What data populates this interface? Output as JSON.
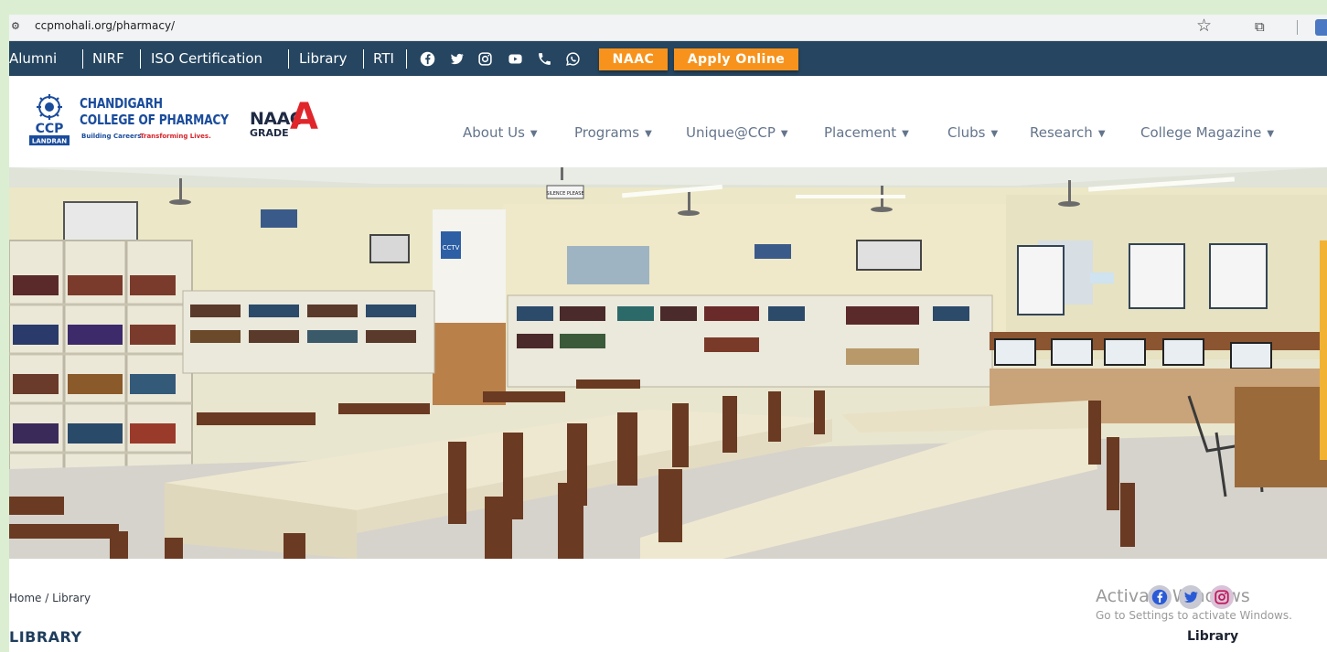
{
  "browser": {
    "url": "ccpmohali.org/pharmacy/"
  },
  "topbar": {
    "links": [
      "Alumni",
      "NIRF",
      "ISO Certification",
      "Library",
      "RTI"
    ],
    "social_icons": [
      "facebook-icon",
      "twitter-icon",
      "instagram-icon",
      "youtube-icon",
      "phone-icon",
      "whatsapp-icon"
    ],
    "naac_label": "NAAC",
    "apply_label": "Apply Online",
    "bar_color": "#254560",
    "accent_color": "#f7931d"
  },
  "logo": {
    "line1": "CHANDIGARH",
    "line2": "COLLEGE OF PHARMACY",
    "badge": "CCP",
    "place": "LANDRAN",
    "tagline_a": "Building Careers.",
    "tagline_b": "Transforming Lives.",
    "naac": "NAAC",
    "grade_label": "GRADE",
    "grade": "A"
  },
  "nav": {
    "items": [
      "About Us",
      "Programs",
      "Unique@CCP",
      "Placement",
      "Clubs",
      "Research",
      "College Magazine"
    ]
  },
  "hero": {
    "description_icon": "library-photo",
    "sign_silence": "SILENCE PLEASE",
    "sign_cctv": "CCTV"
  },
  "breadcrumb": "Home / Library",
  "page_title": "LIBRARY",
  "sidebar_title": "Library",
  "windows_watermark": {
    "line1": "Activate Windows",
    "line2": "Go to Settings to activate Windows."
  },
  "floating_social": [
    "facebook-icon",
    "twitter-icon",
    "instagram-icon"
  ]
}
